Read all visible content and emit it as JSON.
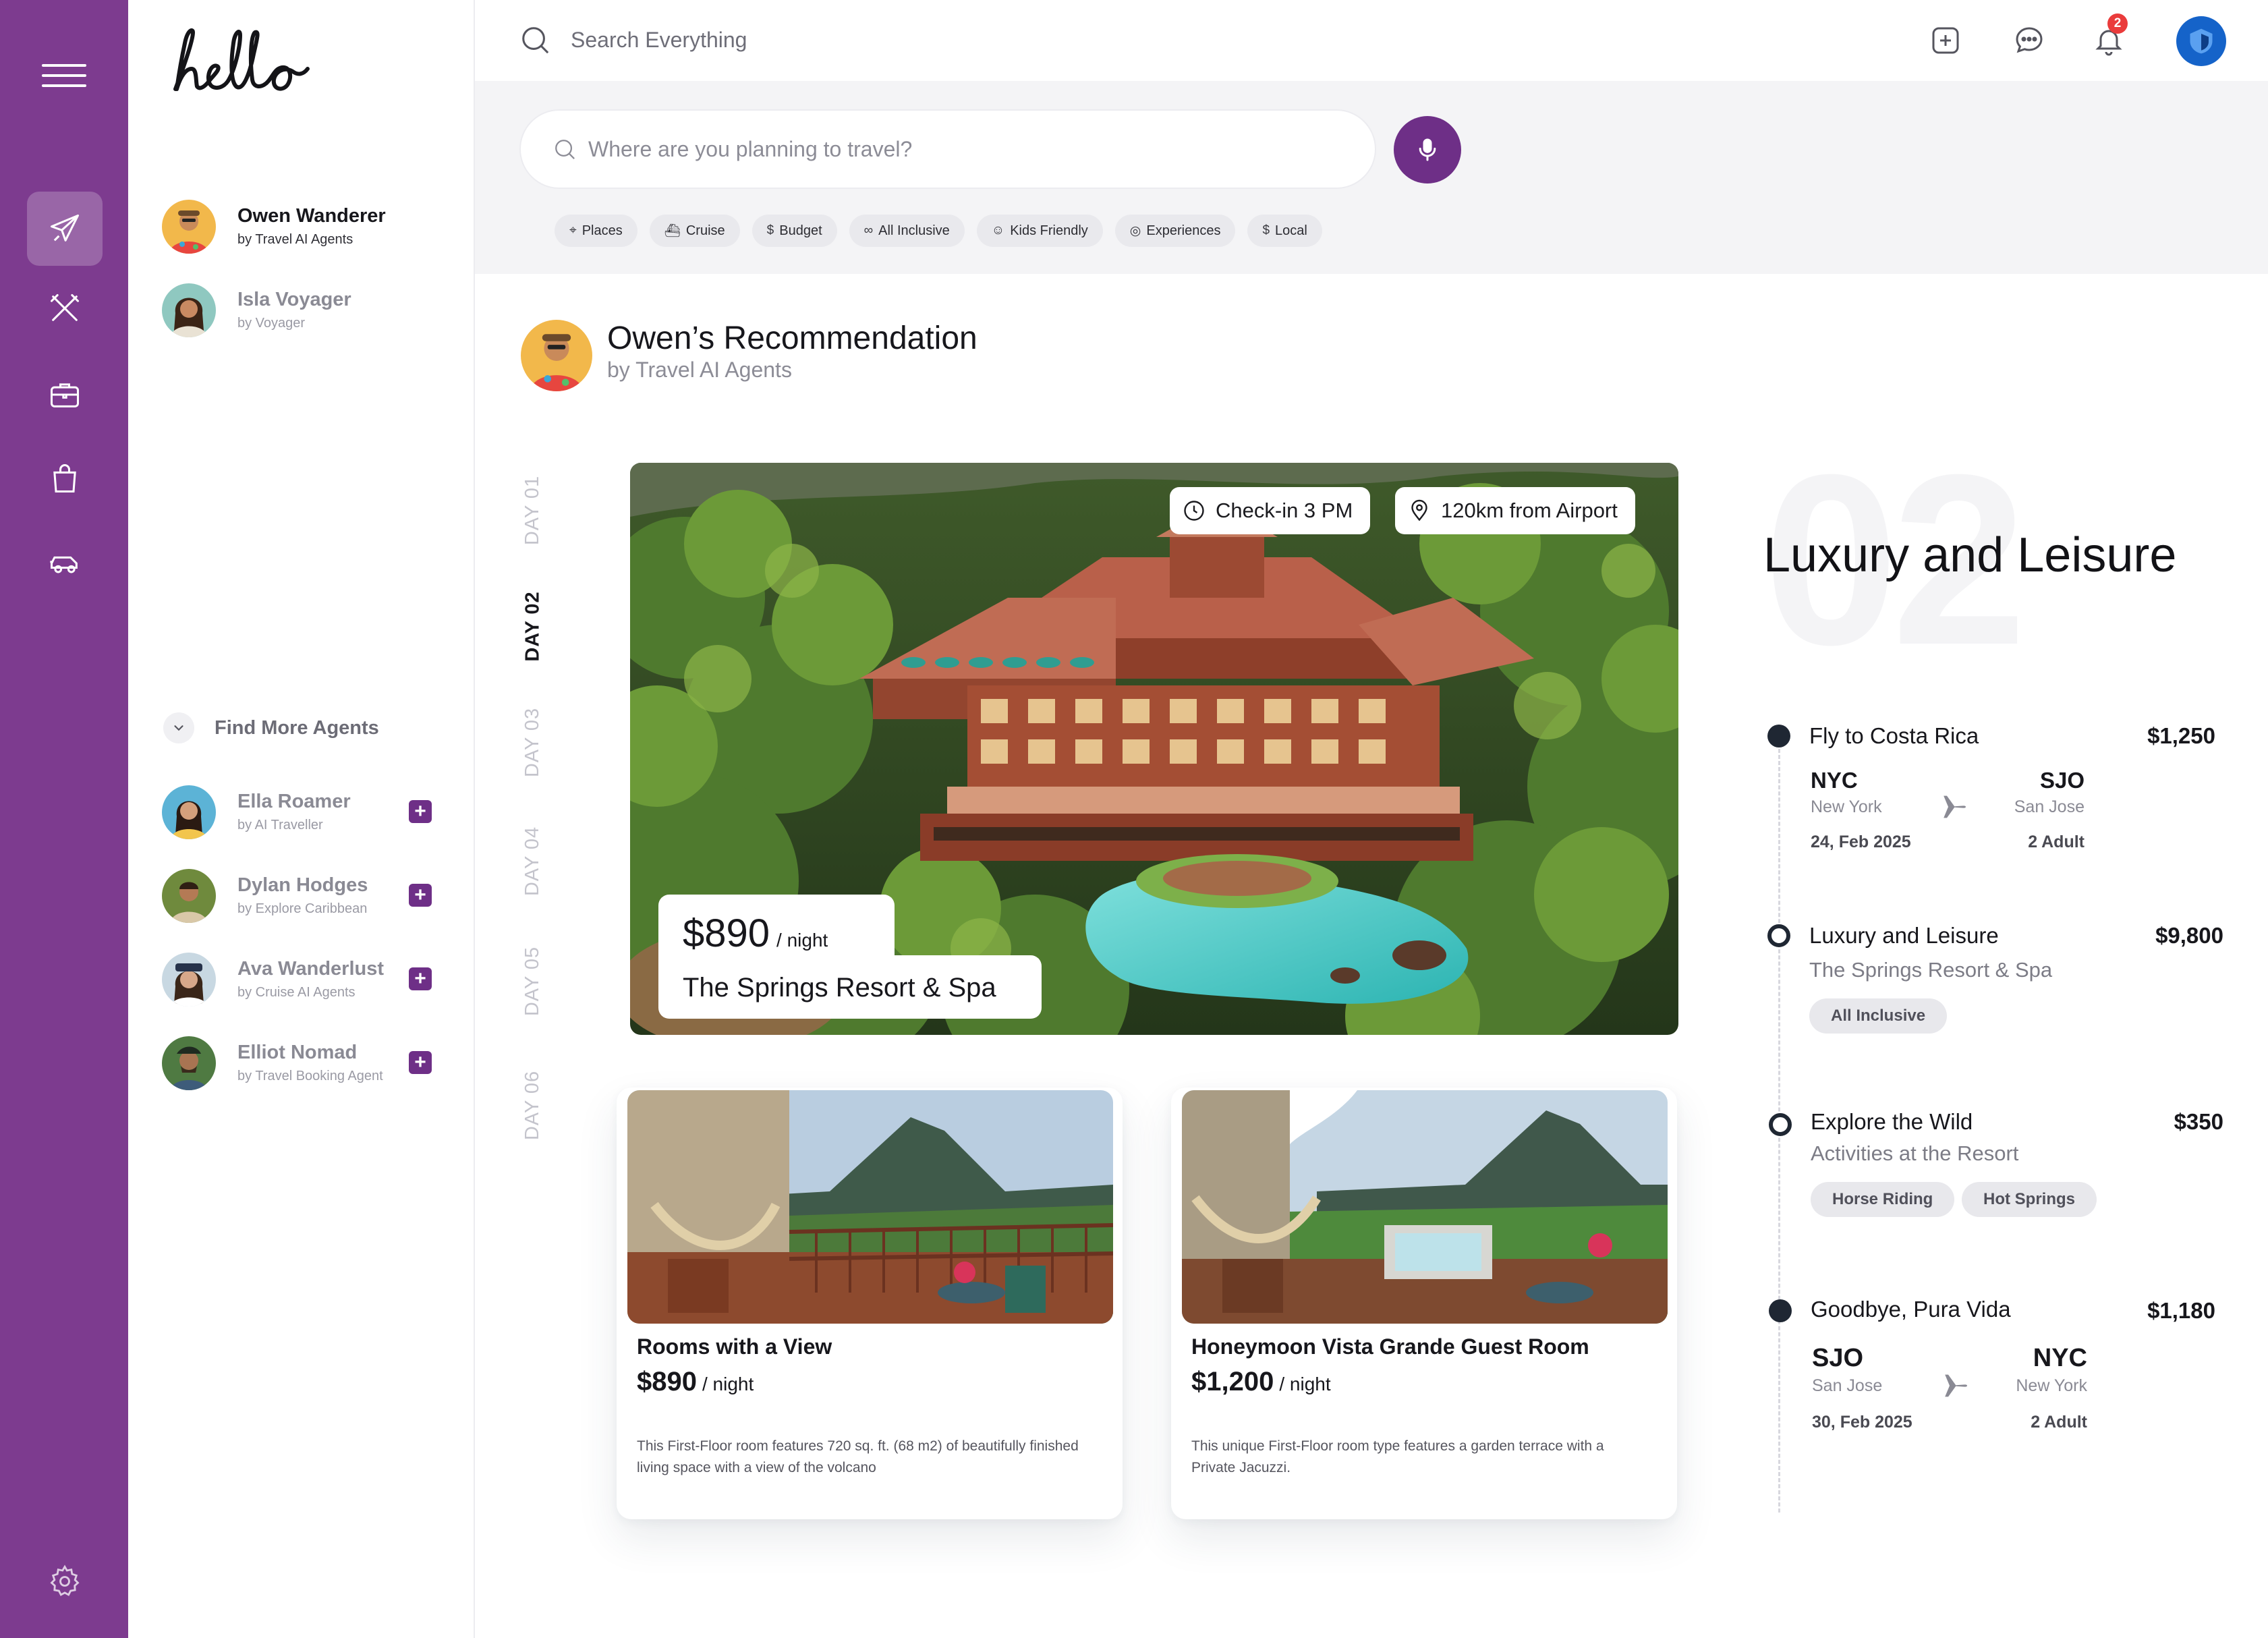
{
  "app": {
    "logo_text": "hello"
  },
  "rail": {
    "items": [
      {
        "icon": "airplane-icon",
        "active": true
      },
      {
        "icon": "utensils-icon",
        "active": false
      },
      {
        "icon": "briefcase-icon",
        "active": false
      },
      {
        "icon": "shopping-bag-icon",
        "active": false
      },
      {
        "icon": "car-icon",
        "active": false
      }
    ],
    "settings_icon": "gear-icon",
    "accent": "#7d3b8f"
  },
  "agents": {
    "selected": [
      {
        "name": "Owen Wanderer",
        "by": "by Travel AI Agents"
      },
      {
        "name": "Isla Voyager",
        "by": "by Voyager"
      }
    ],
    "find_more_label": "Find More Agents",
    "more": [
      {
        "name": "Ella Roamer",
        "by": "by AI Traveller"
      },
      {
        "name": "Dylan Hodges",
        "by": "by Explore Caribbean"
      },
      {
        "name": "Ava Wanderlust",
        "by": "by Cruise AI Agents"
      },
      {
        "name": "Elliot Nomad",
        "by": "by Travel Booking Agent"
      }
    ]
  },
  "topbar": {
    "search_placeholder": "Search Everything",
    "notification_count": "2"
  },
  "planner": {
    "placeholder": "Where are you planning to travel?",
    "chips": [
      {
        "icon": "pin-icon",
        "label": "Places"
      },
      {
        "icon": "ship-icon",
        "label": "Cruise"
      },
      {
        "icon": "dollar-icon",
        "label": "Budget"
      },
      {
        "icon": "link-icon",
        "label": "All Inclusive"
      },
      {
        "icon": "family-icon",
        "label": "Kids Friendly"
      },
      {
        "icon": "camera-icon",
        "label": "Experiences"
      },
      {
        "icon": "dollar-icon",
        "label": "Local"
      }
    ]
  },
  "recommendation": {
    "title": "Owen’s Recommendation",
    "subtitle": "by Travel AI Agents"
  },
  "days": {
    "labels": [
      "DAY 01",
      "DAY 02",
      "DAY 03",
      "DAY 04",
      "DAY 05",
      "DAY 06"
    ],
    "active_index": 1
  },
  "hero": {
    "checkin": "Check-in 3 PM",
    "distance": "120km from Airport",
    "price": "$890",
    "unit": "/ night",
    "name": "The Springs Resort & Spa"
  },
  "rooms": [
    {
      "title": "Rooms with a View",
      "price": "$890",
      "unit": "/ night",
      "description": "This First-Floor room features 720 sq. ft. (68 m2) of beautifully finished living space with a view of the volcano"
    },
    {
      "title": "Honeymoon Vista Grande Guest Room",
      "price": "$1,200",
      "unit": "/ night",
      "description": "This unique First-Floor room type features a garden terrace with a Private Jacuzzi."
    }
  ],
  "itinerary": {
    "day_number": "02",
    "title": "Luxury and Leisure",
    "items": [
      {
        "title": "Fly to Costa Rica",
        "amount": "$1,250",
        "from_code": "NYC",
        "from_city": "New York",
        "to_code": "SJO",
        "to_city": "San Jose",
        "date": "24, Feb 2025",
        "travellers": "2 Adult"
      },
      {
        "title": "Luxury and Leisure",
        "amount": "$9,800",
        "subtitle": "The Springs Resort & Spa",
        "tags": [
          "All Inclusive"
        ]
      },
      {
        "title": "Explore the Wild",
        "amount": "$350",
        "subtitle": "Activities at the Resort",
        "tags": [
          "Horse Riding",
          "Hot Springs"
        ]
      },
      {
        "title": "Goodbye, Pura Vida",
        "amount": "$1,180",
        "from_code": "SJO",
        "from_city": "San Jose",
        "to_code": "NYC",
        "to_city": "New York",
        "date": "30, Feb 2025",
        "travellers": "2 Adult"
      }
    ]
  }
}
